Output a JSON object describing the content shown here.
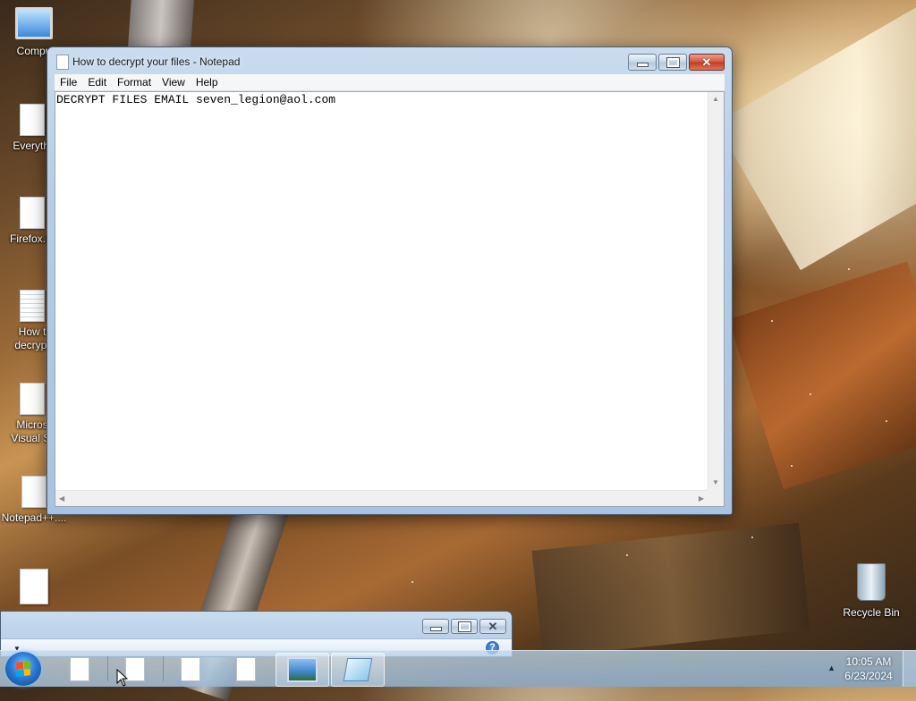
{
  "desktop": {
    "icons": [
      {
        "label": "Compu",
        "icon": "computer-icon"
      },
      {
        "label": "Everythi",
        "icon": "file-icon"
      },
      {
        "label": "Firefox.In",
        "icon": "file-icon"
      },
      {
        "label_line1": "How t",
        "label_line2": "decrypt",
        "icon": "text-file-icon"
      },
      {
        "label_line1": "Micros",
        "label_line2": "Visual St",
        "icon": "file-icon"
      },
      {
        "label": "Notepad++....",
        "icon": "file-icon"
      },
      {
        "label": "",
        "icon": "file-icon"
      }
    ],
    "recycle_bin": {
      "label": "Recycle Bin",
      "icon": "recycle-bin-icon"
    }
  },
  "notepad": {
    "title": "How to decrypt your files - Notepad",
    "menu": [
      "File",
      "Edit",
      "Format",
      "View",
      "Help"
    ],
    "content": "DECRYPT FILES EMAIL seven_legion@aol.com"
  },
  "taskbar": {
    "clock_time": "10:05 AM",
    "clock_date": "6/23/2024"
  },
  "colors": {
    "close_button": "#d2543c",
    "taskbar": "#a6c4de"
  }
}
